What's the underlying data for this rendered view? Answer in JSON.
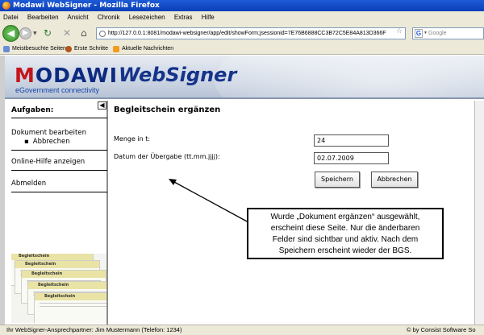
{
  "window": {
    "title": "Modawi WebSigner - Mozilla Firefox"
  },
  "menu": [
    "Datei",
    "Bearbeiten",
    "Ansicht",
    "Chronik",
    "Lesezeichen",
    "Extras",
    "Hilfe"
  ],
  "nav": {
    "url": "http://127.0.0.1:8081/modawi-websigner/app/edit/showForm;jsessionid=7E76B6888CC3B72C5E84A813D366F",
    "search_placeholder": "Google",
    "search_engine_letter": "G"
  },
  "bookmarks": [
    "Meistbesuchte Seiten",
    "Erste Schritte",
    "Aktuelle Nachrichten"
  ],
  "banner": {
    "brand_red": "M",
    "brand_rest": "ODAWI",
    "product": "WebSigner",
    "tagline": "eGovernment connectivity"
  },
  "sidebar": {
    "heading": "Aufgaben:",
    "edit_document": "Dokument bearbeiten",
    "cancel": "Abbrechen",
    "help": "Online-Hilfe anzeigen",
    "logout": "Abmelden",
    "thumb_title": "Begleitschein"
  },
  "main": {
    "title": "Begleitschein ergänzen",
    "quantity_label": "Menge in t:",
    "quantity_value": "24",
    "date_label": "Datum der Übergabe (tt.mm.jjjj):",
    "date_value": "02.07.2009",
    "save_label": "Speichern",
    "cancel_label": "Abbrechen"
  },
  "callout": {
    "line1": "Wurde „Dokument ergänzen“ ausgewählt,",
    "line2": "erscheint diese Seite. Nur die änderbaren",
    "line3": "Felder sind sichtbar und aktiv. Nach dem",
    "line4": "Speichern erscheint wieder der BGS."
  },
  "status": {
    "contact": "Ihr WebSigner-Ansprechpartner: Jim Mustermann (Telefon: 1234)",
    "copyright": "© by Consist Software So"
  },
  "colors": {
    "brand_blue": "#0c2a80",
    "brand_red": "#c4161c",
    "banner_bg": "#c7d1e0"
  }
}
